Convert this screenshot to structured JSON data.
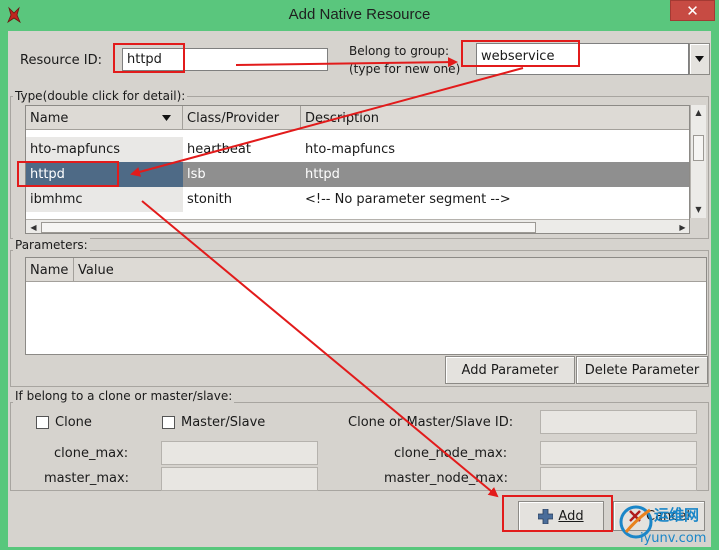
{
  "window": {
    "title": "Add Native Resource",
    "close_glyph": "✕",
    "colors": {
      "titlebar": "#5ac67d",
      "close": "#c74b43",
      "highlight": "#e21b1b"
    }
  },
  "resource_id": {
    "label": "Resource ID:",
    "value": "httpd"
  },
  "group": {
    "label_line1": "Belong to group:",
    "label_line2": "(type for new one)",
    "value": "webservice",
    "dropdown_icon": "triangle-down-icon"
  },
  "type_section": {
    "title": "Type(double click for detail):",
    "columns": [
      "Name",
      "Class/Provider",
      "Description"
    ],
    "sort_icon": "triangle-down-icon",
    "rows": [
      {
        "name": "hto-mapfuncs",
        "provider": "heartbeat",
        "description": "hto-mapfuncs"
      },
      {
        "name": "httpd",
        "provider": "lsb",
        "description": "httpd"
      },
      {
        "name": "ibmhmc",
        "provider": "stonith",
        "description": "<!-- No parameter segment -->"
      }
    ],
    "selected_index": 1
  },
  "parameters": {
    "title": "Parameters:",
    "columns": [
      "Name",
      "Value"
    ],
    "add_label": "Add Parameter",
    "delete_label": "Delete Parameter"
  },
  "clone_section": {
    "title": "If belong to a clone or master/slave:",
    "clone_label": "Clone",
    "master_slave_label": "Master/Slave",
    "clone_id_label": "Clone or Master/Slave ID:",
    "clone_max_label": "clone_max:",
    "clone_node_max_label": "clone_node_max:",
    "master_max_label": "master_max:",
    "master_node_max_label": "master_node_max:"
  },
  "actions": {
    "add_label": "Add",
    "add_icon": "plus-icon",
    "cancel_label": "Cancel",
    "cancel_icon": "x-icon"
  },
  "watermark": {
    "text_cn": "运维网",
    "text_en": "iyunv.com"
  }
}
